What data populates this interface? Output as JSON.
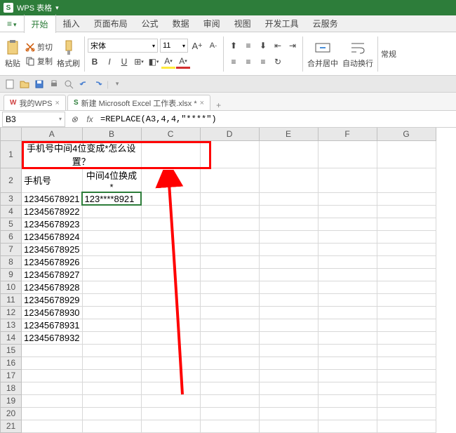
{
  "app": {
    "name": "WPS 表格"
  },
  "menu": {
    "items": [
      "开始",
      "插入",
      "页面布局",
      "公式",
      "数据",
      "审阅",
      "视图",
      "开发工具",
      "云服务"
    ],
    "active_index": 0
  },
  "ribbon": {
    "paste": "粘贴",
    "cut": "剪切",
    "copy": "复制",
    "format_painter": "格式刷",
    "font_name": "宋体",
    "font_size": "11",
    "merge_center": "合并居中",
    "wrap": "自动换行",
    "general": "常规"
  },
  "tabs": {
    "items": [
      {
        "label": "我的WPS",
        "icon": "wps"
      },
      {
        "label": "新建 Microsoft Excel 工作表.xlsx *",
        "icon": "excel"
      }
    ]
  },
  "formula_bar": {
    "name_box": "B3",
    "formula": "=REPLACE(A3,4,4,\"****\")"
  },
  "sheet": {
    "columns": [
      "A",
      "B",
      "C",
      "D",
      "E",
      "F",
      "G"
    ],
    "title_cell": "手机号中间4位变成*怎么设置？",
    "header_a": "手机号",
    "header_b": "中间4位换成*",
    "selected_value": "123****8921",
    "phone_numbers": [
      "12345678921",
      "12345678922",
      "12345678923",
      "12345678924",
      "12345678925",
      "12345678926",
      "12345678927",
      "12345678928",
      "12345678929",
      "12345678930",
      "12345678931",
      "12345678932"
    ],
    "visible_rows": 21
  }
}
